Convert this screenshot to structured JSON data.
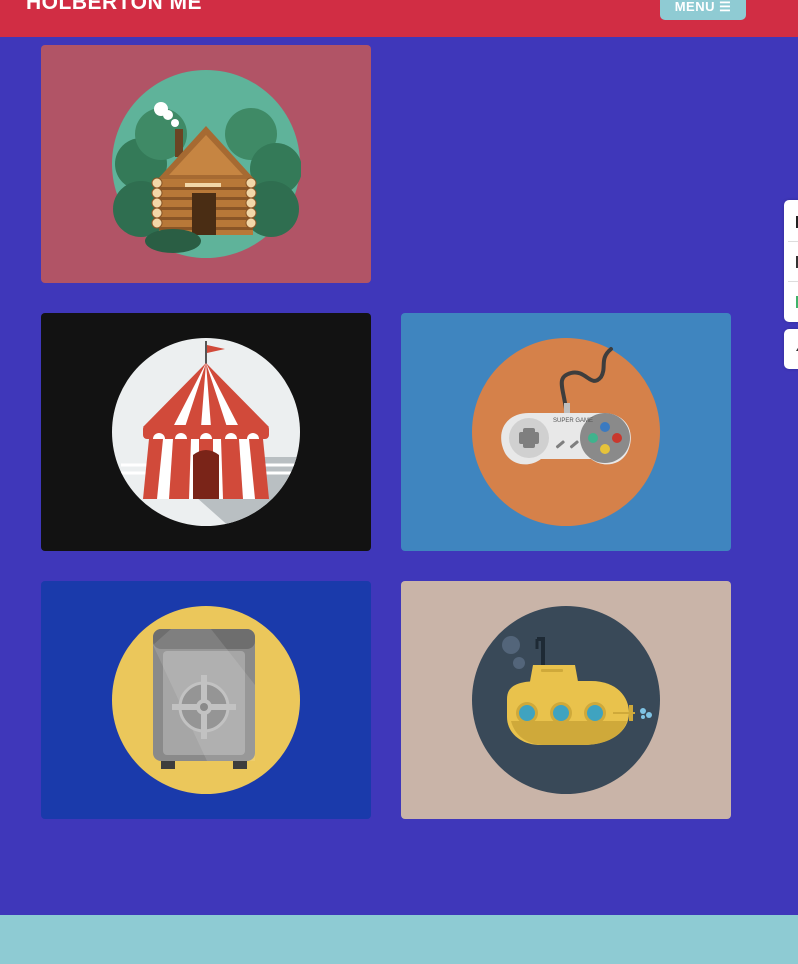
{
  "header": {
    "brand": "HOLBERTON ME",
    "menu_label": "MENU ☰"
  },
  "portfolio": {
    "items": [
      {
        "name": "log-cabin",
        "icon": "log-cabin-icon",
        "bg": "#b15466"
      },
      {
        "name": "circus-tent",
        "icon": "circus-tent-icon",
        "bg": "#121212"
      },
      {
        "name": "game-controller",
        "icon": "game-controller-icon",
        "bg": "#3f85bf"
      },
      {
        "name": "safe",
        "icon": "safe-icon",
        "bg": "#1a3aab"
      },
      {
        "name": "submarine",
        "icon": "submarine-icon",
        "bg": "#c9b4a8"
      }
    ],
    "controller_label": "SUPER GAME"
  },
  "colors": {
    "page_bg": "#3f37ba",
    "header_bg": "#d12d44",
    "menu_bg": "#8fcbd3",
    "footer_bg": "#8ecbd3"
  },
  "share_bar": {
    "icons": [
      "share-icon-1",
      "share-icon-2",
      "share-icon-3"
    ],
    "scroll_up": "arrow-up-icon"
  }
}
